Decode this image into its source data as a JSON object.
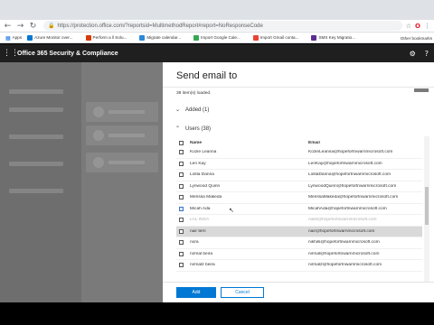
{
  "browser": {
    "url": "https://protection.office.com/?reportsid=MultimethodReport#report=NoResponseCode",
    "bookmarks": [
      {
        "label": "Apps",
        "color": "#1a73e8"
      },
      {
        "label": "Azure Monitor over...",
        "color": "#0078d4"
      },
      {
        "label": "Perform a ll Solu...",
        "color": "#d83b01"
      },
      {
        "label": "Migrate calendar...",
        "color": "#2b88d8"
      },
      {
        "label": "Import Google Cale...",
        "color": "#34a853"
      },
      {
        "label": "Import Gmail conta...",
        "color": "#ea4335"
      },
      {
        "label": "SMS Key Migratio...",
        "color": "#5c2d91"
      }
    ],
    "other_bookmarks": "Other bookmarks"
  },
  "header": {
    "title": "Office 365 Security & Compliance"
  },
  "panel": {
    "title": "Send email to",
    "items_loaded": "38 item(s) loaded.",
    "added_section": "Added (1)",
    "users_section": "Users (38)",
    "columns": {
      "name": "Name",
      "email": "Email"
    },
    "rows": [
      {
        "name": "Kozie Leanna",
        "email": "KozieLeanna@hopefortnwarnmicrosoft.com",
        "state": "normal"
      },
      {
        "name": "Len Kay",
        "email": "LenKay@hopefortnwarnmicrosoft.com",
        "state": "normal"
      },
      {
        "name": "Lolita Danna",
        "email": "LolitaDanna@hopefortnwarnmicrosoft.com",
        "state": "normal"
      },
      {
        "name": "Lynwood Quinn",
        "email": "LynwoodQuinn@hopefortnwarnmicrosoft.com",
        "state": "normal"
      },
      {
        "name": "Merissa Makeda",
        "email": "MerissaMakeda@hopefortnwarnmicrosoft.com",
        "state": "normal"
      },
      {
        "name": "Micah Ada",
        "email": "MicahAda@hopefortnwarnmicrosoft.com",
        "state": "hover"
      },
      {
        "name": "LAL INDA",
        "email": "nidel@hopefortnwarnmicrosoft.com",
        "state": "dim"
      },
      {
        "name": "nair terri",
        "email": "nair@hopefortnwarnmicrosoft.com",
        "state": "highlight"
      },
      {
        "name": "nora",
        "email": "nikhils@hopefortnwarnmicrosoft.com",
        "state": "normal"
      },
      {
        "name": "nirmal beira",
        "email": "nirmal@hopefortnwarnmicrosoft.com",
        "state": "normal"
      },
      {
        "name": "nirmal2 beira",
        "email": "nirmal2@hopefortnwarnmicrosoft.com",
        "state": "normal"
      }
    ],
    "add_label": "Add",
    "cancel_label": "Cancel"
  },
  "colors": {
    "accent": "#0078d4",
    "header_bg": "#1f1f1f"
  }
}
